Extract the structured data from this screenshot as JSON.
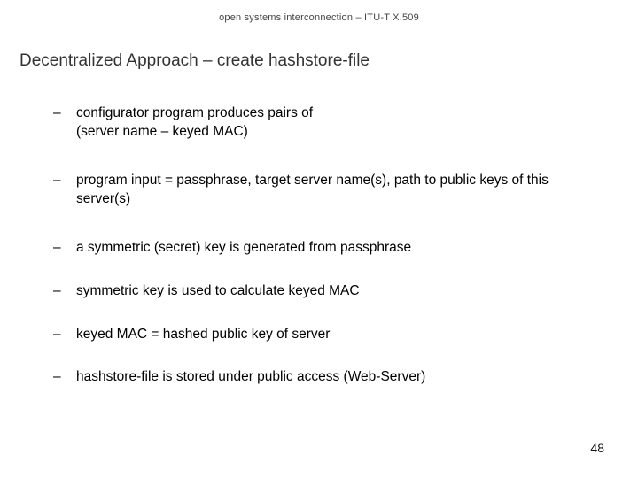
{
  "header": "open systems interconnection – ITU-T X.509",
  "title": "Decentralized Approach – create hashstore-file",
  "bullets": [
    "configurator program produces pairs of\n(server name – keyed MAC)",
    "program input = passphrase, target server name(s), path to public keys of this server(s)",
    "a symmetric (secret) key is generated from passphrase",
    "symmetric key is used to calculate keyed MAC",
    "keyed MAC = hashed public key of server",
    "hashstore-file is stored under public access (Web-Server)"
  ],
  "dash": "–",
  "page_number": "48"
}
